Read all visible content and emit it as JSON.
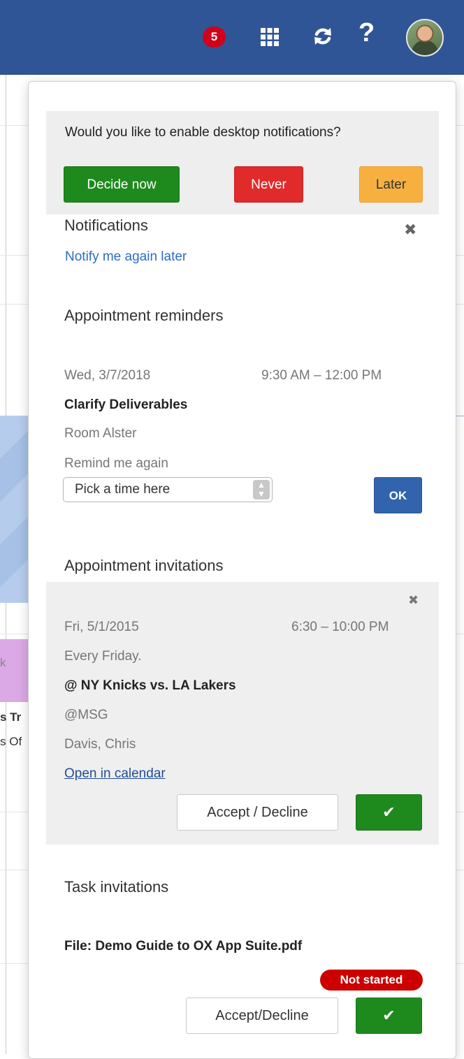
{
  "topbar": {
    "notification_count": "5",
    "icons": [
      "apps-grid-icon",
      "refresh-icon",
      "help-icon",
      "avatar"
    ],
    "help_glyph": "?"
  },
  "background": {
    "fragment_1": "s Tr",
    "fragment_2": "s Of",
    "fragment_3": "k"
  },
  "desktop_prompt": {
    "question": "Would you like to enable desktop notifications?",
    "decide_label": "Decide now",
    "never_label": "Never",
    "later_label": "Later",
    "colors": {
      "decide": "#1e8a1e",
      "never": "#e12a2a",
      "later": "#f7b040"
    }
  },
  "notifications": {
    "title": "Notifications",
    "close_glyph": "✖",
    "notify_later_link": "Notify me again later"
  },
  "reminders": {
    "section_title": "Appointment reminders",
    "date": "Wed, 3/7/2018",
    "time": "9:30 AM – 12:00 PM",
    "title": "Clarify Deliverables",
    "location": "Room Alster",
    "remind_label": "Remind me again",
    "select_placeholder": "Pick a time here",
    "ok_label": "OK"
  },
  "invitations": {
    "section_title": "Appointment invitations",
    "close_glyph": "✖",
    "date": "Fri, 5/1/2015",
    "time": "6:30 – 10:00 PM",
    "recurrence": "Every Friday.",
    "title": "@ NY Knicks vs. LA Lakers",
    "location": "@MSG",
    "organizer": "Davis, Chris",
    "open_link": "Open in calendar",
    "accept_label": "Accept / Decline",
    "confirm_glyph": "✔"
  },
  "tasks": {
    "section_title": "Task invitations",
    "title": "File: Demo Guide to OX App Suite.pdf",
    "status": "Not started",
    "accept_label": "Accept/Decline",
    "confirm_glyph": "✔"
  }
}
